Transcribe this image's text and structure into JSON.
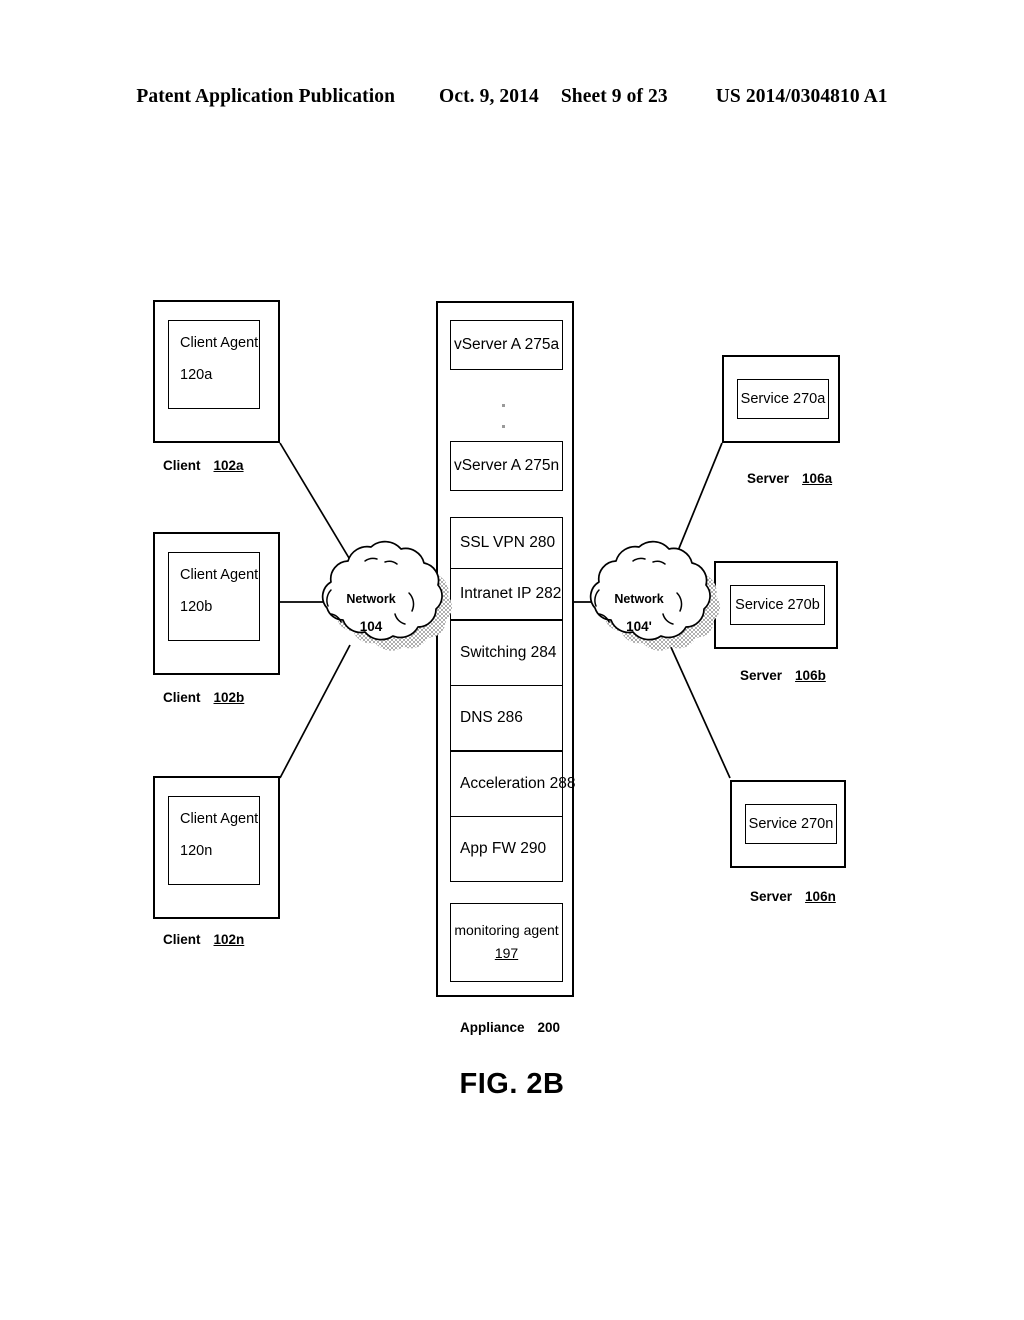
{
  "header": {
    "publication": "Patent Application Publication",
    "date": "Oct. 9, 2014",
    "sheet": "Sheet 9 of 23",
    "number": "US 2014/0304810 A1"
  },
  "figure": {
    "caption": "FIG. 2B"
  },
  "clients": [
    {
      "agent_name": "Client Agent",
      "agent_id": "120a",
      "label": "Client",
      "ref": "102a"
    },
    {
      "agent_name": "Client Agent",
      "agent_id": "120b",
      "label": "Client",
      "ref": "102b"
    },
    {
      "agent_name": "Client Agent",
      "agent_id": "120n",
      "label": "Client",
      "ref": "102n"
    }
  ],
  "networks": [
    {
      "name": "Network",
      "ref": "104"
    },
    {
      "name": "Network",
      "ref": "104'"
    }
  ],
  "appliance": {
    "label": "Appliance",
    "ref": "200",
    "vservers": [
      {
        "text": "vServer A 275a"
      },
      {
        "text": "vServer A 275n"
      }
    ],
    "ellipsis": "vertical-ellipsis",
    "services": [
      {
        "text": "SSL VPN 280"
      },
      {
        "text": "Intranet IP 282"
      },
      {
        "text": "Switching 284"
      },
      {
        "text": "DNS 286"
      },
      {
        "text": "Acceleration 288"
      },
      {
        "text": "App FW 290"
      }
    ],
    "monitoring_agent": {
      "name": "monitoring agent",
      "ref": "197"
    }
  },
  "servers": [
    {
      "service": "Service 270a",
      "label": "Server",
      "ref": "106a"
    },
    {
      "service": "Service 270b",
      "label": "Server",
      "ref": "106b"
    },
    {
      "service": "Service 270n",
      "label": "Server",
      "ref": "106n"
    }
  ],
  "colors": {
    "ink": "#000000",
    "paper": "#ffffff",
    "cloud_shadow": "#8a8a8a",
    "ellipsis_dot": "#9a9a9a"
  }
}
